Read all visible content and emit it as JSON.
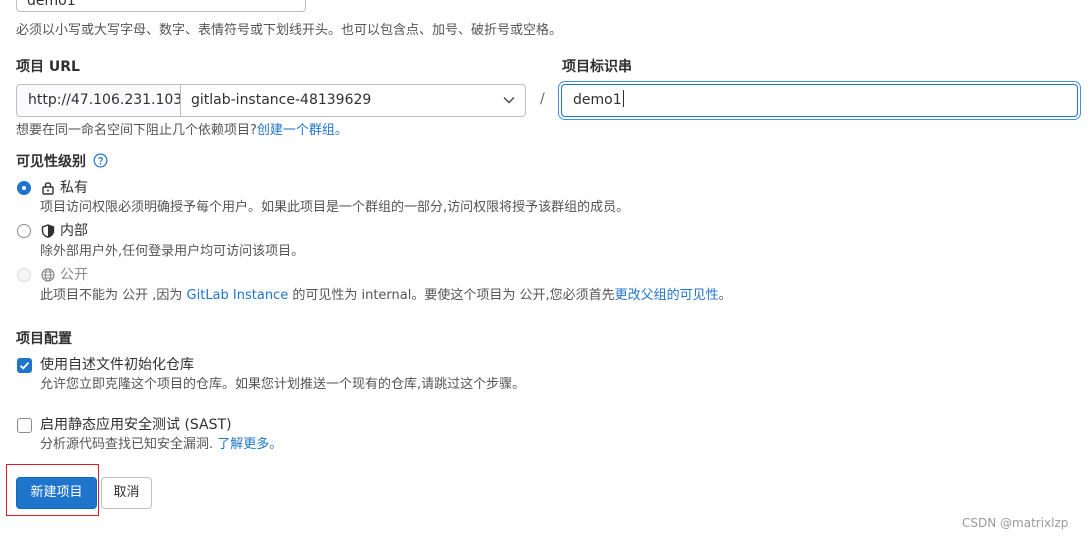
{
  "project_name": {
    "value": "demo1",
    "hint": "必须以小写或大写字母、数字、表情符号或下划线开头。也可以包含点、加号、破折号或空格。"
  },
  "project_url": {
    "label": "项目 URL",
    "prefix": "http://47.106.231.103/",
    "namespace": "gitlab-instance-48139629",
    "separator": "/",
    "hint_prefix": "想要在同一命名空间下阻止几个依赖项目?",
    "hint_link": "创建一个群组。"
  },
  "project_slug": {
    "label": "项目标识串",
    "value": "demo1"
  },
  "visibility": {
    "label": "可见性级别",
    "help_icon": "question-circle-icon",
    "options": [
      {
        "label": "私有",
        "icon": "lock-icon",
        "description": "项目访问权限必须明确授予每个用户。如果此项目是一个群组的一部分,访问权限将授予该群组的成员。",
        "selected": true
      },
      {
        "label": "内部",
        "icon": "shield-icon",
        "description": "除外部用户外,任何登录用户均可访问该项目。",
        "selected": false
      },
      {
        "label": "公开",
        "icon": "earth-icon",
        "description_part1": "此项目不能为 公开 ,因为 ",
        "description_link1": "GitLab Instance",
        "description_part2": " 的可见性为 internal。要使这个项目为 公开,您必须首先",
        "description_link2": "更改父组的可见性",
        "description_part3": "。",
        "selected": false,
        "disabled": true
      }
    ]
  },
  "config": {
    "label": "项目配置",
    "readme": {
      "label": "使用自述文件初始化仓库",
      "description": "允许您立即克隆这个项目的仓库。如果您计划推送一个现有的仓库,请跳过这个步骤。",
      "checked": true
    },
    "sast": {
      "label": "启用静态应用安全测试 (SAST)",
      "description_prefix": "分析源代码查找已知安全漏洞.",
      "link": "了解更多。",
      "checked": false
    }
  },
  "buttons": {
    "create": "新建项目",
    "cancel": "取消"
  },
  "watermark": "CSDN @matrixlzp",
  "colors": {
    "primary": "#1f75cb",
    "highlight": "#d81e2b"
  }
}
